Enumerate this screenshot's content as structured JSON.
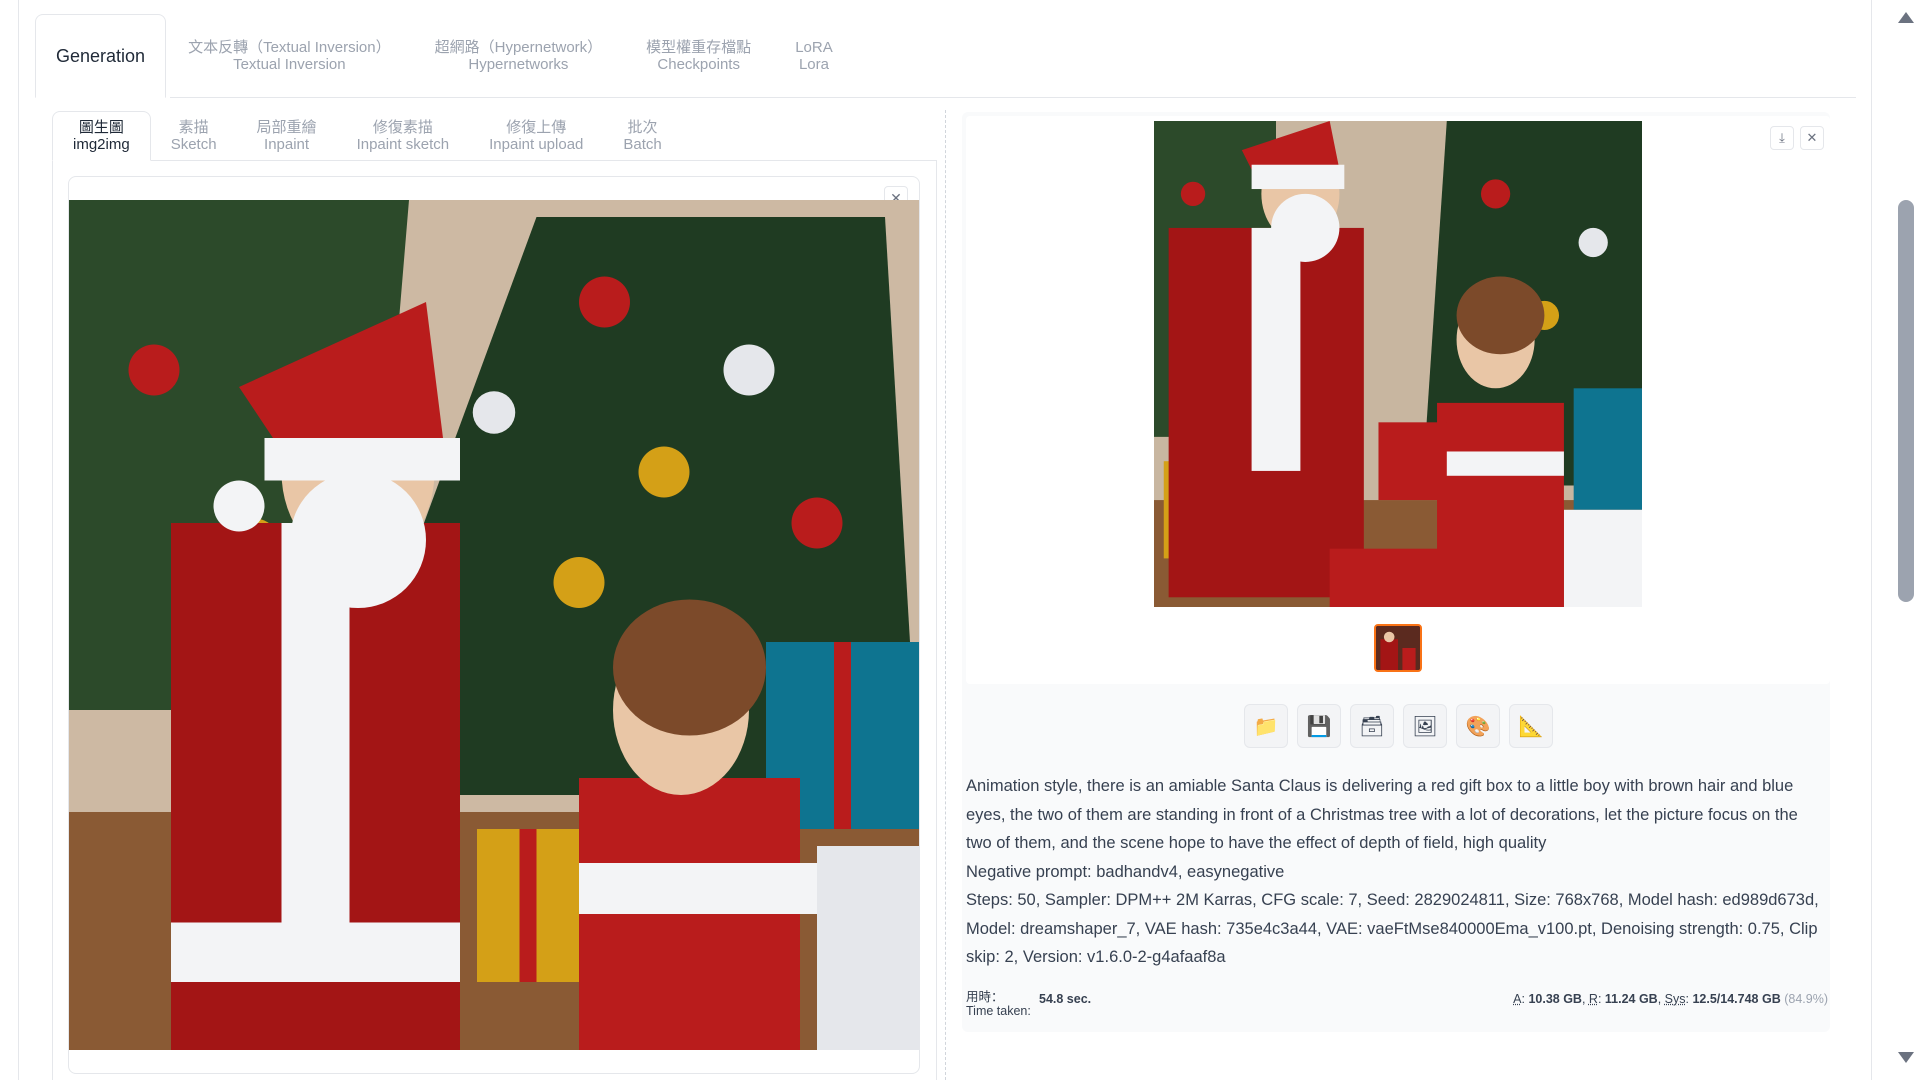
{
  "top_tabs": [
    {
      "line1": "Generation",
      "line2": ""
    },
    {
      "line1": "文本反轉（Textual Inversion）",
      "line2": "Textual Inversion"
    },
    {
      "line1": "超網路（Hypernetwork）",
      "line2": "Hypernetworks"
    },
    {
      "line1": "模型權重存檔點",
      "line2": "Checkpoints"
    },
    {
      "line1": "LoRA",
      "line2": "Lora"
    }
  ],
  "sub_tabs": [
    {
      "line1": "圖生圖",
      "line2": "img2img"
    },
    {
      "line1": "素描",
      "line2": "Sketch"
    },
    {
      "line1": "局部重繪",
      "line2": "Inpaint"
    },
    {
      "line1": "修復素描",
      "line2": "Inpaint sketch"
    },
    {
      "line1": "修復上傳",
      "line2": "Inpaint upload"
    },
    {
      "line1": "批次",
      "line2": "Batch"
    }
  ],
  "icons": {
    "close": "✕",
    "download": "⤓",
    "folder": "📁",
    "save": "💾",
    "zip": "🗃",
    "send_img2img": "🖼",
    "send_inpaint": "🎨",
    "send_extras": "📐"
  },
  "generation_info": {
    "prompt": "Animation style, there is an amiable Santa Claus is delivering a red gift box to a little boy with brown hair and blue eyes, the two of them are standing in front of a Christmas tree with a lot of decorations, let the picture focus on the two of them, and the scene hope to have the effect of depth of field, high quality",
    "negative": "Negative prompt: badhandv4, easynegative",
    "params": "Steps: 50, Sampler: DPM++ 2M Karras, CFG scale: 7, Seed: 2829024811, Size: 768x768, Model hash: ed989d673d, Model: dreamshaper_7, VAE hash: 735e4c3a44, VAE: vaeFtMse840000Ema_v100.pt, Denoising strength: 0.75, Clip skip: 2, Version: v1.6.0-2-g4afaaf8a"
  },
  "timer": {
    "label_zh": "用時：",
    "label_en": "Time taken:",
    "value": "54.8 sec."
  },
  "memory": {
    "a_label": "A",
    "a_value": "10.38 GB",
    "r_label": "R",
    "r_value": "11.24 GB",
    "sys_label": "Sys",
    "sys_value": "12.5/14.748 GB",
    "sys_pct": "(84.9%)"
  },
  "colors": {
    "accent": "#f97316",
    "border": "#e5e7eb",
    "muted_text": "#9ca3af",
    "text": "#374151"
  }
}
